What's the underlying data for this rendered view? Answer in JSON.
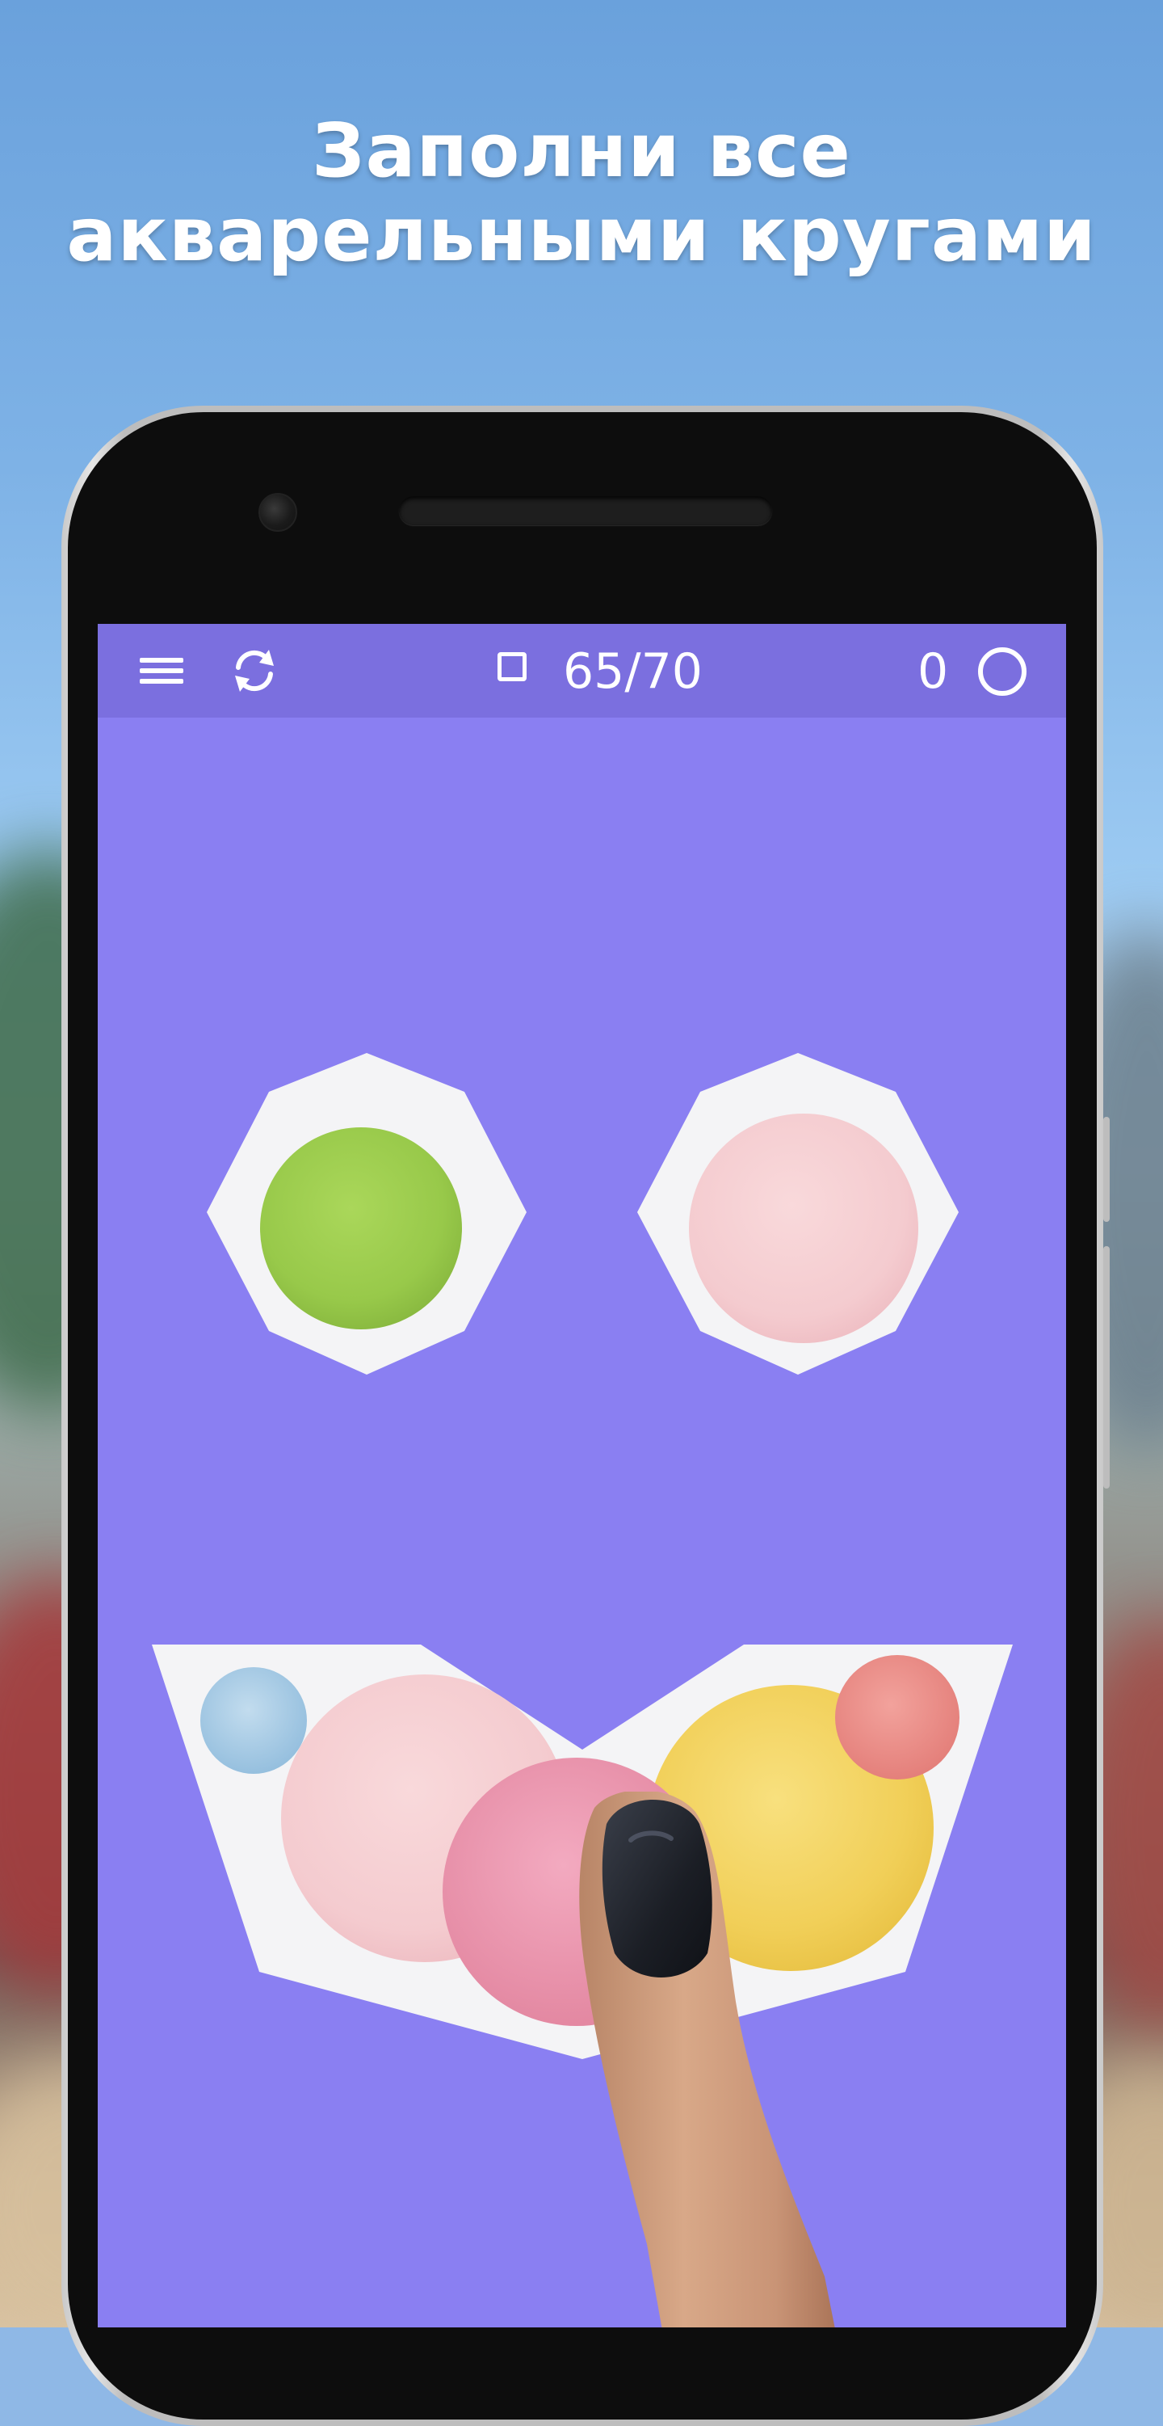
{
  "promo": {
    "headline_line1": "Заполни все",
    "headline_line2": "акварельными кругами"
  },
  "toolbar": {
    "menu_icon": "hamburger-menu-icon",
    "restart_icon": "restart-icon",
    "shapes_icon": "square-outline-icon",
    "progress": "65/70",
    "score": "0",
    "circles_icon": "circle-outline-icon"
  },
  "game": {
    "colors": {
      "background": "#8a7ff2",
      "toolbar": "#7b6fdf",
      "shape_fill": "#f4f4f6",
      "circle_green": "#9fcf4d",
      "circle_pink_light": "#f6cfd2",
      "circle_blue": "#a9cde6",
      "circle_yellow": "#f3d35c",
      "circle_coral": "#eb8b86",
      "circle_pink": "#ec94ad"
    }
  }
}
